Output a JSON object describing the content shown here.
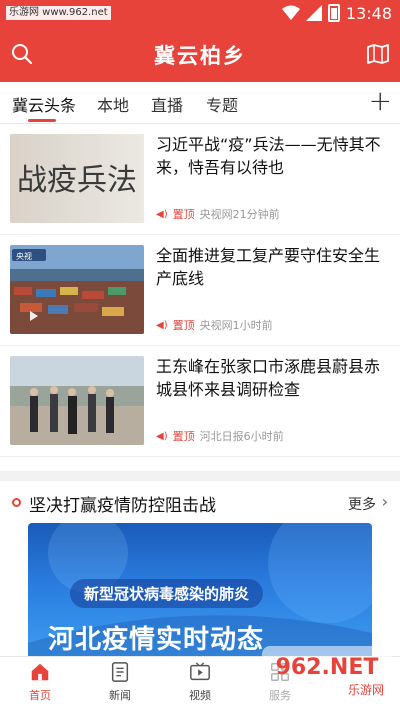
{
  "status": {
    "watermark": "乐游网 www.962.net",
    "time": "13:48"
  },
  "app": {
    "title": "冀云柏乡"
  },
  "tabs": [
    {
      "label": "冀云头条"
    },
    {
      "label": "本地"
    },
    {
      "label": "直播"
    },
    {
      "label": "专题"
    }
  ],
  "feed": [
    {
      "title": "习近平战“疫”兵法——无恃其不来，恃吾有以待也",
      "pin": "置顶",
      "source": "央视网21分钟前"
    },
    {
      "title": "全面推进复工复产要守住安全生产底线",
      "pin": "置顶",
      "source": "央视网1小时前"
    },
    {
      "title": "王东峰在张家口市涿鹿县蔚县赤城县怀来县调研检查",
      "pin": "置顶",
      "source": "河北日报6小时前"
    }
  ],
  "section": {
    "title": "坚决打赢疫情防控阻击战",
    "more": "更多"
  },
  "banner": {
    "line1": "新型冠状病毒感染的肺炎",
    "line2": "河北疫情实时动态"
  },
  "thumb1_text": "战疫兵法",
  "thumb2_text": "央视",
  "bottom_nav": [
    {
      "label": "首页"
    },
    {
      "label": "新闻"
    },
    {
      "label": "视频"
    },
    {
      "label": "服务"
    }
  ],
  "watermark2": {
    "brand": "962.NET",
    "sub": "乐游网"
  },
  "colors": {
    "brand": "#e8433a",
    "banner": "#2b7de0"
  },
  "icons": {
    "search": "search-icon",
    "map": "map-icon",
    "add": "plus-icon",
    "home": "home-icon",
    "news": "news-icon",
    "video": "video-icon",
    "service": "service-icon"
  }
}
